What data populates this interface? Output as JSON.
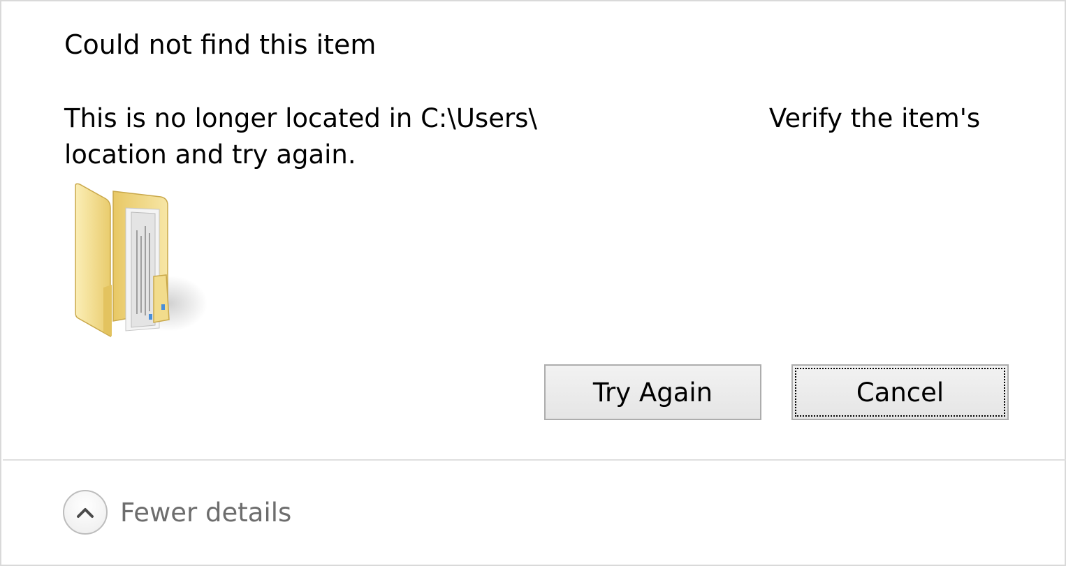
{
  "dialog": {
    "heading": "Could not find this item",
    "message_part1": "This is no longer located in C:\\Users\\",
    "message_part2": "Verify the item's",
    "message_line2": "location and try again.",
    "icon": "folder-icon"
  },
  "buttons": {
    "try_again_label": "Try Again",
    "cancel_label": "Cancel"
  },
  "footer": {
    "details_label": "Fewer details",
    "details_icon": "chevron-up-icon"
  },
  "colors": {
    "folder_yellow": "#f3dc8b",
    "button_border": "#adadad",
    "muted_text": "#6d6d6d"
  }
}
